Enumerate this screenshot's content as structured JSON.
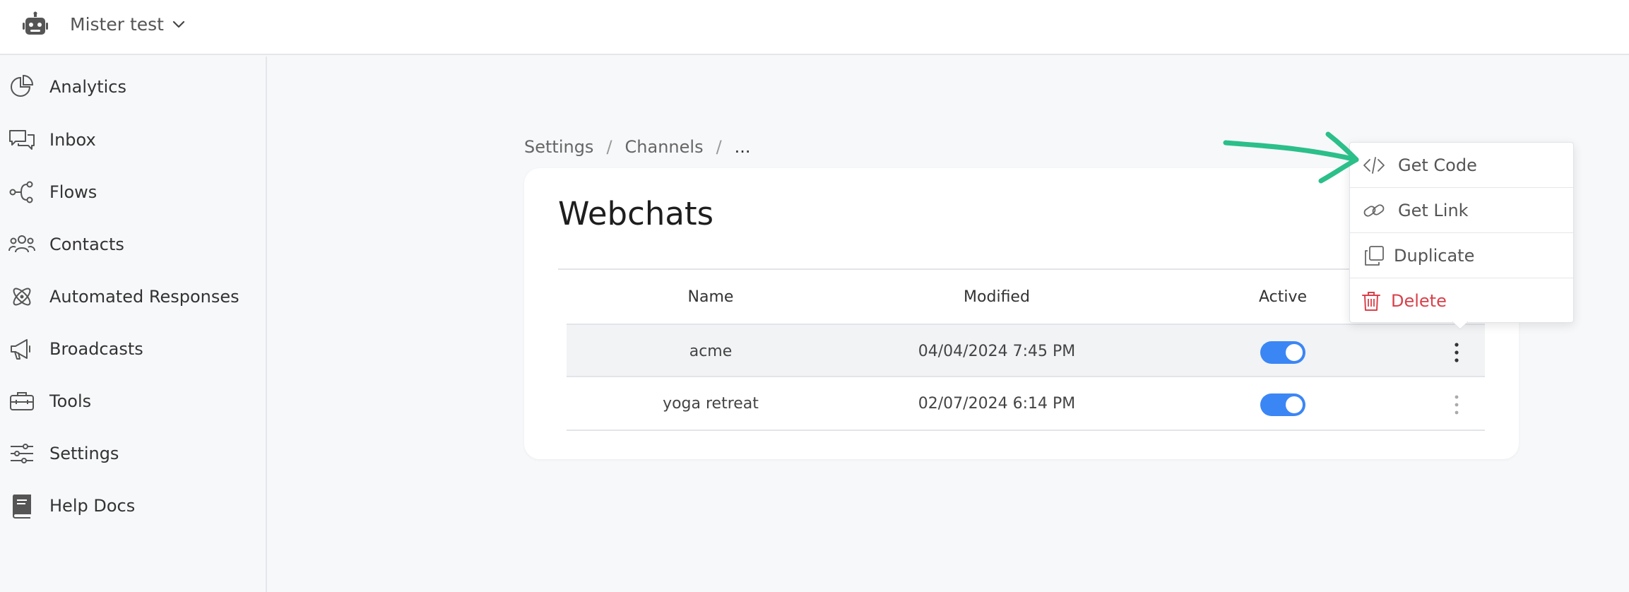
{
  "header": {
    "workspace_name": "Mister test"
  },
  "sidebar": {
    "items": [
      {
        "label": "Analytics",
        "icon": "pie-chart-icon"
      },
      {
        "label": "Inbox",
        "icon": "chat-bubbles-icon"
      },
      {
        "label": "Flows",
        "icon": "flow-nodes-icon"
      },
      {
        "label": "Contacts",
        "icon": "people-icon"
      },
      {
        "label": "Automated Responses",
        "icon": "atom-icon"
      },
      {
        "label": "Broadcasts",
        "icon": "megaphone-icon"
      },
      {
        "label": "Tools",
        "icon": "toolbox-icon"
      },
      {
        "label": "Settings",
        "icon": "sliders-icon"
      },
      {
        "label": "Help Docs",
        "icon": "book-icon"
      }
    ]
  },
  "breadcrumb": {
    "items": [
      "Settings",
      "Channels",
      "..."
    ],
    "separator": "/"
  },
  "page": {
    "title": "Webchats"
  },
  "table": {
    "columns": [
      "Name",
      "Modified",
      "Active"
    ],
    "rows": [
      {
        "name": "acme",
        "modified": "04/04/2024 7:45 PM",
        "active": true
      },
      {
        "name": "yoga retreat",
        "modified": "02/07/2024 6:14 PM",
        "active": true
      }
    ]
  },
  "menu": {
    "items": [
      {
        "label": "Get Code",
        "icon": "code-icon"
      },
      {
        "label": "Get Link",
        "icon": "link-icon"
      },
      {
        "label": "Duplicate",
        "icon": "copy-icon"
      },
      {
        "label": "Delete",
        "icon": "trash-icon"
      }
    ]
  },
  "colors": {
    "accent": "#3b86f5",
    "danger": "#d9414b",
    "annotation_arrow": "#2bbf8a"
  }
}
